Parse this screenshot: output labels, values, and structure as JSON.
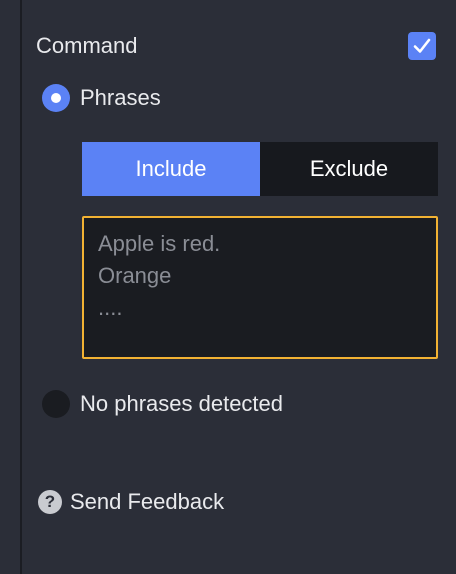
{
  "command": {
    "label": "Command",
    "checked": true
  },
  "mode": {
    "phrases_label": "Phrases",
    "phrases_selected": true,
    "none_label": "No phrases detected",
    "none_selected": false
  },
  "filter": {
    "include_label": "Include",
    "exclude_label": "Exclude",
    "active": "include"
  },
  "phrases_input": {
    "placeholder": "Apple is red.\nOrange\n....",
    "value": ""
  },
  "feedback": {
    "label": "Send Feedback",
    "icon_glyph": "?"
  },
  "colors": {
    "background": "#2b2e38",
    "accent": "#5b82f5",
    "focus_border": "#f2b233",
    "field_background": "#1a1c21"
  }
}
